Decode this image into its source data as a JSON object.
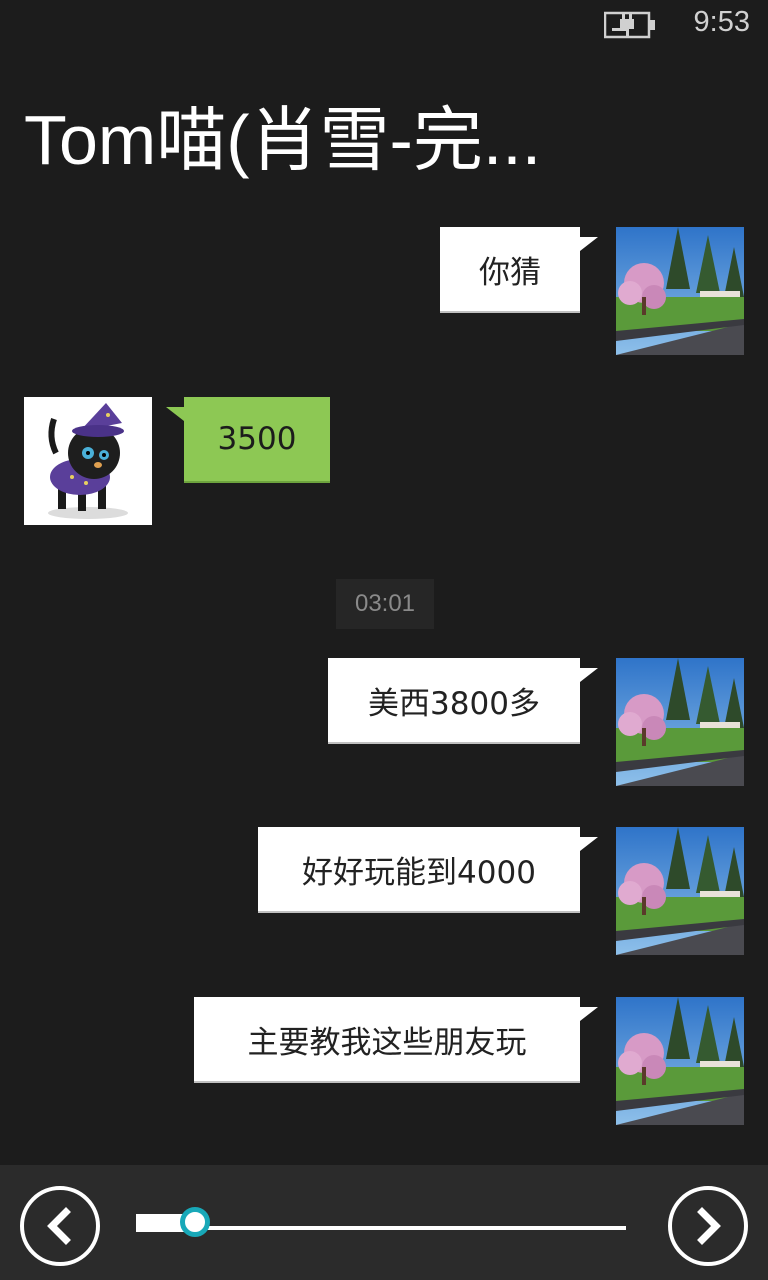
{
  "status_bar": {
    "time": "9:53",
    "battery_icon": "battery-charging-icon"
  },
  "header": {
    "title": "Tom喵(肖雪-完..."
  },
  "messages": [
    {
      "direction": "outgoing",
      "text": "你猜",
      "avatar": "landscape-avatar"
    },
    {
      "direction": "incoming",
      "text": "3500",
      "avatar": "black-cat-avatar"
    },
    {
      "direction": "outgoing",
      "text": "美西3800多",
      "avatar": "landscape-avatar"
    },
    {
      "direction": "outgoing",
      "text": "好好玩能到4000",
      "avatar": "landscape-avatar"
    },
    {
      "direction": "outgoing",
      "text": "主要教我这些朋友玩",
      "avatar": "landscape-avatar"
    }
  ],
  "timestamp_label": "03:01",
  "playback": {
    "prev_icon": "chevron-left-icon",
    "next_icon": "chevron-right-icon",
    "progress_fraction": 0.12
  },
  "colors": {
    "background": "#1c1c1c",
    "incoming_bubble": "#8dc854",
    "outgoing_bubble": "#ffffff",
    "slider_accent": "#18a8b8"
  }
}
